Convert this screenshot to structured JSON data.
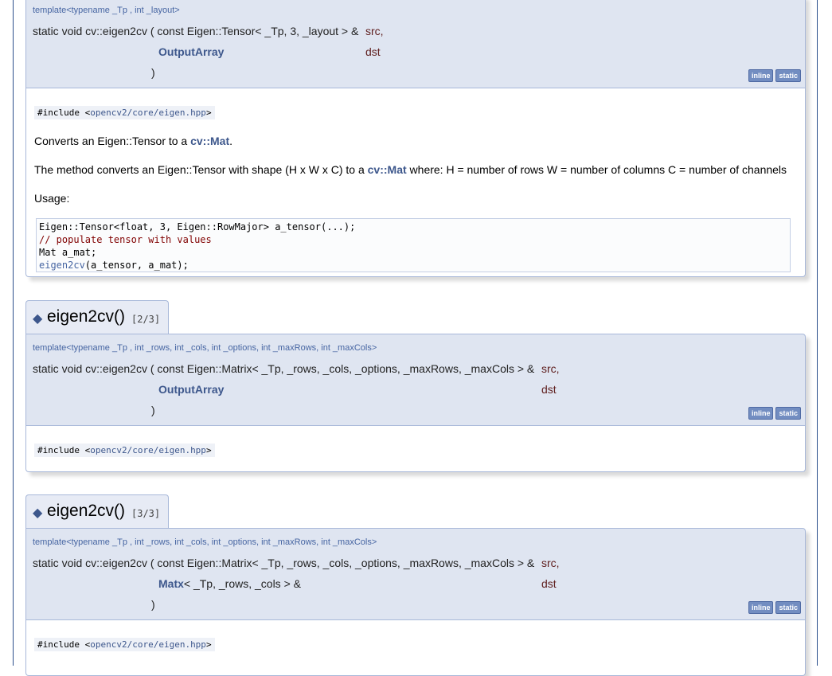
{
  "entries": [
    {
      "template": "template<typename _Tp , int _layout>",
      "signature_prefix": "static void cv::eigen2cv ( const Eigen::Tensor< _Tp, 3, _layout > &",
      "param1": "src,",
      "param2_type": "OutputArray",
      "param2_name": "dst",
      "close": ")",
      "badges": [
        "inline",
        "static"
      ],
      "include_prefix": "#include <",
      "include_path": "opencv2/core/eigen.hpp",
      "include_suffix": ">",
      "brief": {
        "before": "Converts an Eigen::Tensor to a ",
        "link": "cv::Mat",
        "after": "."
      },
      "detail": {
        "before": "The method converts an Eigen::Tensor with shape (H x W x C) to a ",
        "link": "cv::Mat",
        "after": " where: H = number of rows W = number of columns C = number of channels"
      },
      "usage_label": "Usage:",
      "code": {
        "line1": "Eigen::Tensor<float, 3, Eigen::RowMajor> a_tensor(...);",
        "line2": "// populate tensor with values",
        "line3": "Mat a_mat;",
        "line4_fn": "eigen2cv",
        "line4_rest": "(a_tensor, a_mat);"
      }
    },
    {
      "title": "eigen2cv()",
      "overload": "[2/3]",
      "template": "template<typename _Tp , int _rows, int _cols, int _options, int _maxRows, int _maxCols>",
      "signature_prefix": "static void cv::eigen2cv ( const Eigen::Matrix< _Tp, _rows, _cols, _options, _maxRows, _maxCols > &",
      "param1": "src,",
      "param2_type": "OutputArray",
      "param2_name": "dst",
      "close": ")",
      "badges": [
        "inline",
        "static"
      ],
      "include_prefix": "#include <",
      "include_path": "opencv2/core/eigen.hpp",
      "include_suffix": ">"
    },
    {
      "title": "eigen2cv()",
      "overload": "[3/3]",
      "template": "template<typename _Tp , int _rows, int _cols, int _options, int _maxRows, int _maxCols>",
      "signature_prefix": "static void cv::eigen2cv ( const Eigen::Matrix< _Tp, _rows, _cols, _options, _maxRows, _maxCols > &",
      "param1": "src,",
      "param2_type": "Matx",
      "param2_type_rest": "< _Tp, _rows, _cols > &",
      "param2_name": "dst",
      "close": ")",
      "badges": [
        "inline",
        "static"
      ],
      "include_prefix": "#include <",
      "include_path": "opencv2/core/eigen.hpp",
      "include_suffix": ">"
    }
  ],
  "diamond": "◆",
  "colors": {
    "link": "#3d578c",
    "proto_bg": "#dfe5f1",
    "border": "#a8b8d9",
    "badge": "#728dc1",
    "param": "#602020"
  }
}
